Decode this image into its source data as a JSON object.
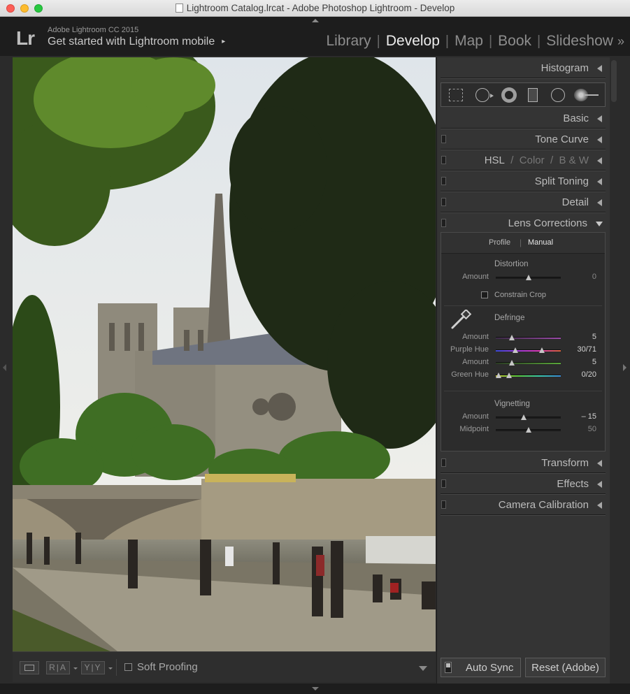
{
  "window": {
    "title": "Lightroom Catalog.lrcat - Adobe Photoshop Lightroom - Develop"
  },
  "identity": {
    "logo": "Lr",
    "product": "Adobe Lightroom CC 2015",
    "tagline": "Get started with Lightroom mobile",
    "tagline_arrow": "▸"
  },
  "modules": {
    "items": [
      "Library",
      "Develop",
      "Map",
      "Book",
      "Slideshow"
    ],
    "active": "Develop",
    "separator": "|",
    "more": "»"
  },
  "panels": {
    "histogram": "Histogram",
    "basic": "Basic",
    "tone_curve": "Tone Curve",
    "hsl": {
      "a": "HSL",
      "sep": "/",
      "b": "Color",
      "c": "B & W"
    },
    "split_toning": "Split Toning",
    "detail": "Detail",
    "lens_corrections": "Lens Corrections",
    "transform": "Transform",
    "effects": "Effects",
    "camera_calibration": "Camera Calibration"
  },
  "lens": {
    "tabs": {
      "profile": "Profile",
      "sep": "|",
      "manual": "Manual",
      "active": "Manual"
    },
    "distortion": {
      "title": "Distortion",
      "amount_label": "Amount",
      "amount_value": "0",
      "amount_level": 0.5,
      "constrain_crop_label": "Constrain Crop",
      "constrain_crop_checked": false
    },
    "defringe": {
      "title": "Defringe",
      "purple_amount_label": "Amount",
      "purple_amount_value": "5",
      "purple_amount_level": 0.25,
      "purple_hue_label": "Purple Hue",
      "purple_hue_value": "30/71",
      "purple_hue_range": [
        0.3,
        0.71
      ],
      "green_amount_label": "Amount",
      "green_amount_value": "5",
      "green_amount_level": 0.25,
      "green_hue_label": "Green Hue",
      "green_hue_value": "0/20",
      "green_hue_range": [
        0.0,
        0.2
      ]
    },
    "vignetting": {
      "title": "Vignetting",
      "amount_label": "Amount",
      "amount_value": "– 15",
      "amount_level": 0.425,
      "midpoint_label": "Midpoint",
      "midpoint_value": "50",
      "midpoint_level": 0.5
    }
  },
  "toolbar": {
    "ra_label": "R|A",
    "yy_label": "Y|Y",
    "soft_proofing_label": "Soft Proofing",
    "soft_proofing_checked": false
  },
  "footer": {
    "auto_sync_label": "Auto Sync",
    "reset_label": "Reset (Adobe)"
  },
  "colors": {
    "panel_bg": "#343434",
    "chrome_bg": "#1d1d1d",
    "active_module": "#ececec",
    "inactive_module": "#8d8d8d"
  }
}
